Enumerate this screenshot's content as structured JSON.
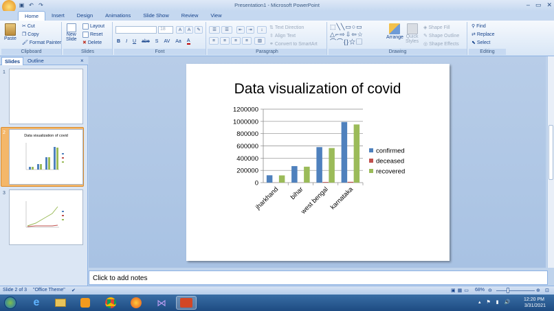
{
  "window": {
    "title": "Presentation1 - Microsoft PowerPoint"
  },
  "tabs": [
    "Home",
    "Insert",
    "Design",
    "Animations",
    "Slide Show",
    "Review",
    "View"
  ],
  "ribbon": {
    "clipboard": {
      "paste": "Paste",
      "cut": "Cut",
      "copy": "Copy",
      "format_painter": "Format Painter",
      "label": "Clipboard"
    },
    "slides": {
      "new_slide": "New",
      "new_slide2": "Slide",
      "layout": "Layout",
      "reset": "Reset",
      "delete": "Delete",
      "label": "Slides"
    },
    "font": {
      "size": "18",
      "label": "Font",
      "bold": "B",
      "italic": "I",
      "underline": "U",
      "strike": "abe",
      "shadow": "S",
      "spacing": "AV",
      "case": "Aa",
      "color": "A"
    },
    "paragraph": {
      "text_direction": "Text Direction",
      "align_text": "Align Text",
      "convert_smartart": "Convert to SmartArt",
      "label": "Paragraph"
    },
    "drawing": {
      "arrange": "Arrange",
      "quick_styles": "Quick",
      "quick_styles2": "Styles",
      "shape_fill": "Shape Fill",
      "shape_outline": "Shape Outline",
      "shape_effects": "Shape Effects",
      "label": "Drawing"
    },
    "editing": {
      "find": "Find",
      "replace": "Replace",
      "select": "Select",
      "label": "Editing"
    }
  },
  "panel": {
    "tab_slides": "Slides",
    "tab_outline": "Outline",
    "close": "×",
    "slide_numbers": [
      "1",
      "2",
      "3"
    ],
    "thumb2_title": "Data visualization of covid"
  },
  "chart_data": {
    "type": "bar",
    "title": "Data visualization of covid",
    "categories": [
      "jharkhand",
      "bihar",
      "west bengal",
      "karnataka"
    ],
    "series": [
      {
        "name": "confirmed",
        "color": "#4f81bd",
        "values": [
          120000,
          270000,
          580000,
          990000
        ]
      },
      {
        "name": "deceased",
        "color": "#c0504d",
        "values": [
          1000,
          1500,
          10000,
          13000
        ]
      },
      {
        "name": "recovered",
        "color": "#9bbb59",
        "values": [
          118000,
          260000,
          565000,
          950000
        ]
      }
    ],
    "ylim": [
      0,
      1200000
    ],
    "yticks": [
      0,
      200000,
      400000,
      600000,
      800000,
      1000000,
      1200000
    ],
    "grid": true,
    "legend": "right"
  },
  "notes": {
    "placeholder": "Click to add notes"
  },
  "status": {
    "slide": "Slide 2 of 3",
    "theme": "\"Office Theme\"",
    "zoom": "68%"
  },
  "tray": {
    "time": "12:20 PM",
    "date": "3/31/2021"
  }
}
